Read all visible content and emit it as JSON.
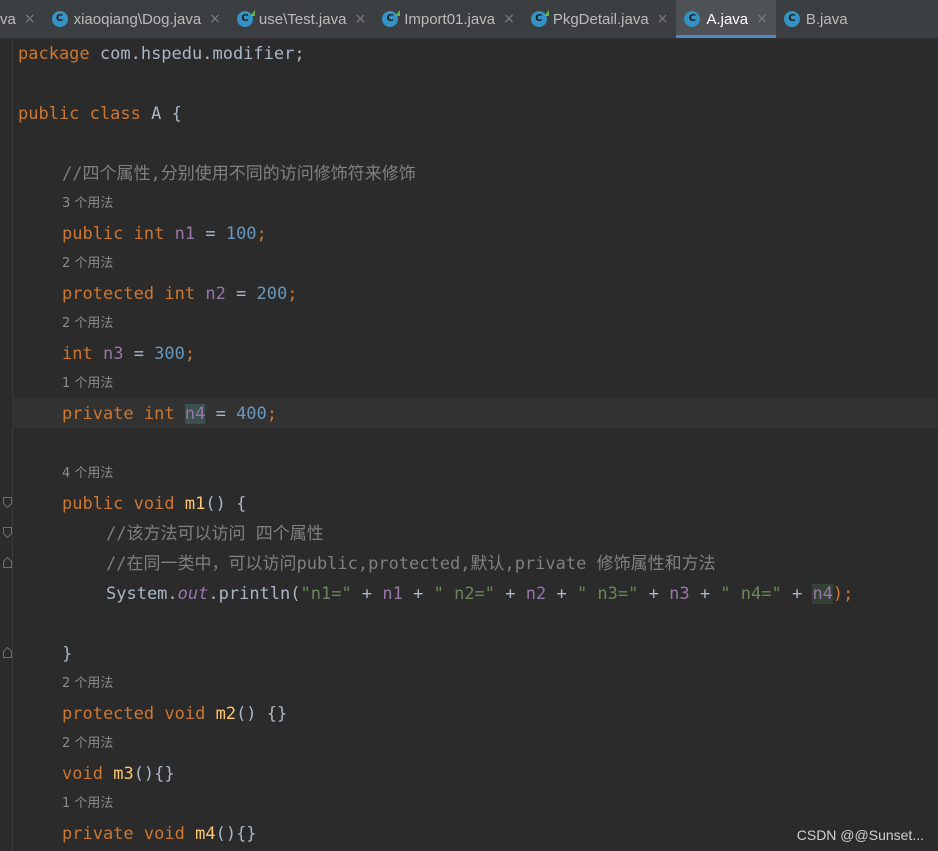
{
  "tabs": [
    {
      "label": "va",
      "icon": null,
      "active": false
    },
    {
      "label": "xiaoqiang\\Dog.java",
      "icon": "java-class-icon",
      "active": false
    },
    {
      "label": "use\\Test.java",
      "icon": "java-runnable-class-icon",
      "active": false
    },
    {
      "label": "Import01.java",
      "icon": "java-runnable-class-icon",
      "active": false
    },
    {
      "label": "PkgDetail.java",
      "icon": "java-runnable-class-icon",
      "active": false
    },
    {
      "label": "A.java",
      "icon": "java-class-icon",
      "active": true
    },
    {
      "label": "B.java",
      "icon": "java-class-icon",
      "active": false
    }
  ],
  "tab_icon_letter": "C",
  "close_glyph": "×",
  "code": {
    "package_kw": "package",
    "package_name": " com.hspedu.modifier;",
    "class_decl": {
      "kw1": "public",
      "kw2": "class",
      "name": "A",
      "brace": "{"
    },
    "comment_fields": "//四个属性,分别使用不同的访问修饰符来修饰",
    "fields": [
      {
        "hint": "3 个用法",
        "modifier": "public ",
        "type": "int",
        "name": "n1",
        "value": "100"
      },
      {
        "hint": "2 个用法",
        "modifier": "protected ",
        "type": "int",
        "name": "n2",
        "value": "200"
      },
      {
        "hint": "2 个用法",
        "modifier": "",
        "type": "int",
        "name": "n3",
        "value": "300"
      },
      {
        "hint": "1 个用法",
        "modifier": "private ",
        "type": "int",
        "name": "n4",
        "value": "400"
      }
    ],
    "m1": {
      "hint": "4 个用法",
      "kw1": "public",
      "kw2": "void",
      "name": "m1",
      "comment1": "//该方法可以访问 四个属性",
      "comment2": "//在同一类中，可以访问public,protected,默认,private 修饰属性和方法",
      "print": {
        "system": "System.",
        "out": "out",
        "println": ".println(",
        "s1": "\"n1=\"",
        "v1": "n1",
        "s2": "\" n2=\"",
        "v2": "n2",
        "s3": "\" n3=\"",
        "v3": "n3",
        "s4": "\" n4=\"",
        "v4": "n4",
        "end": ");"
      },
      "close_brace": "}"
    },
    "methods": [
      {
        "hint": "2 个用法",
        "modifier": "protected",
        "name": "m2",
        "body": "() {}"
      },
      {
        "hint": "2 个用法",
        "modifier": "",
        "name": "m3",
        "body": "(){}"
      },
      {
        "hint": "1 个用法",
        "modifier": "private",
        "name": "m4",
        "body": "(){}"
      }
    ],
    "void_kw": "void"
  },
  "watermark": "CSDN @@Sunset...",
  "colors": {
    "background": "#2b2b2b",
    "keyword": "#cc7832",
    "number": "#6897bb",
    "field": "#9876aa",
    "string": "#6a8759",
    "comment": "#808080",
    "method": "#ffc66d",
    "tab_active_underline": "#4a88c7"
  }
}
